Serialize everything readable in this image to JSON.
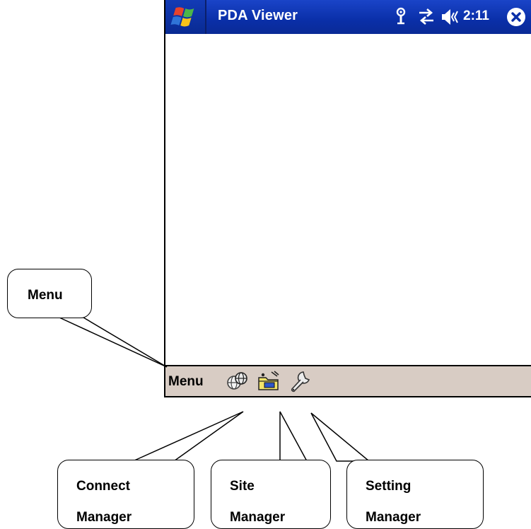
{
  "window": {
    "title": "PDA Viewer",
    "clock": "2:11"
  },
  "icons": {
    "start": "windows-start-flag-icon",
    "antenna": "antenna-icon",
    "connectivity": "connectivity-arrows-icon",
    "volume": "speaker-volume-icon",
    "close": "close-circle-icon",
    "connect_manager": "globe-connect-icon",
    "site_manager": "folder-sites-icon",
    "setting_manager": "wrench-settings-icon"
  },
  "menubar": {
    "menu_label": "Menu"
  },
  "callouts": {
    "menu": "Menu",
    "connect": {
      "line1": "Connect",
      "line2": "Manager"
    },
    "site": {
      "line1": "Site",
      "line2": "Manager"
    },
    "setting": {
      "line1": "Setting",
      "line2": "Manager"
    }
  },
  "colors": {
    "titlebar": "#0a2fa8",
    "menubar": "#d8ccc4"
  }
}
